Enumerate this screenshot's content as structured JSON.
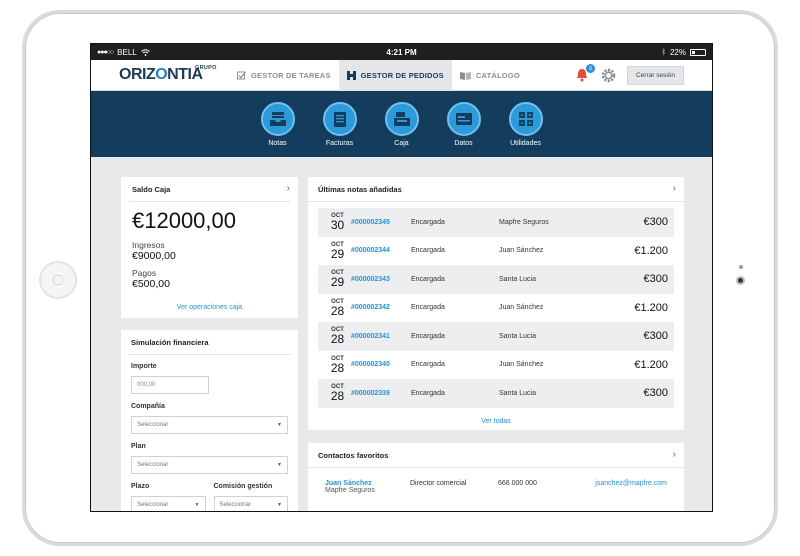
{
  "statusbar": {
    "carrier": "BELL",
    "time": "4:21 PM",
    "battery": "22%"
  },
  "brand": {
    "grupo": "GRUPO",
    "name_a": "ORIZ",
    "name_o": "O",
    "name_b": "NTIA"
  },
  "nav": {
    "tabs": [
      {
        "label": "GESTOR DE TAREAS"
      },
      {
        "label": "GESTOR DE PEDIDOS"
      },
      {
        "label": "CATÁLOGO"
      }
    ],
    "notifications": "9",
    "logout": "Cerrar sesión"
  },
  "toolbar": {
    "items": [
      {
        "label": "Notas"
      },
      {
        "label": "Facturas"
      },
      {
        "label": "Caja"
      },
      {
        "label": "Datos"
      },
      {
        "label": "Utilidades"
      }
    ]
  },
  "saldo": {
    "title": "Saldo Caja",
    "total": "€12000,00",
    "ingresos_label": "Ingresos",
    "ingresos": "€9000,00",
    "pagos_label": "Pagos",
    "pagos": "€500,00",
    "link": "Ver operaciones caja"
  },
  "simulacion": {
    "title": "Simulación financiera",
    "importe_label": "Importe",
    "importe_placeholder": "000,00",
    "compania_label": "Compañía",
    "plan_label": "Plan",
    "plazo_label": "Plazo",
    "comision_label": "Comisión gestión",
    "select_placeholder": "Seleccionar"
  },
  "notas": {
    "title": "Últimas notas añadidas",
    "rows": [
      {
        "month": "OCT",
        "day": "30",
        "id": "#000002345",
        "state": "Encargada",
        "client": "Mapfre Seguros",
        "amount": "€300"
      },
      {
        "month": "OCT",
        "day": "29",
        "id": "#000002344",
        "state": "Encargada",
        "client": "Juan Sánchez",
        "amount": "€1.200"
      },
      {
        "month": "OCT",
        "day": "29",
        "id": "#000002343",
        "state": "Encargada",
        "client": "Santa Lucia",
        "amount": "€300"
      },
      {
        "month": "OCT",
        "day": "28",
        "id": "#000002342",
        "state": "Encargada",
        "client": "Juan Sánchez",
        "amount": "€1.200"
      },
      {
        "month": "OCT",
        "day": "28",
        "id": "#000002341",
        "state": "Encargada",
        "client": "Santa Lucia",
        "amount": "€300"
      },
      {
        "month": "OCT",
        "day": "28",
        "id": "#000002340",
        "state": "Encargada",
        "client": "Juan Sánchez",
        "amount": "€1.200"
      },
      {
        "month": "OCT",
        "day": "28",
        "id": "#000002339",
        "state": "Encargada",
        "client": "Santa Lucia",
        "amount": "€300"
      }
    ],
    "link": "Ver todas"
  },
  "contactos": {
    "title": "Contactos favoritos",
    "rows": [
      {
        "name": "Juan Sánchez",
        "company": "Mapfre Seguros",
        "role": "Director comercial",
        "phone": "666 000 000",
        "email": "jsanchez@mapfre.com"
      }
    ]
  },
  "colors": {
    "brand": "#1d3b55",
    "accent": "#2d9ad9",
    "toolbar": "#143d5d",
    "link": "#2a90d8",
    "alert": "#e84c3d"
  }
}
